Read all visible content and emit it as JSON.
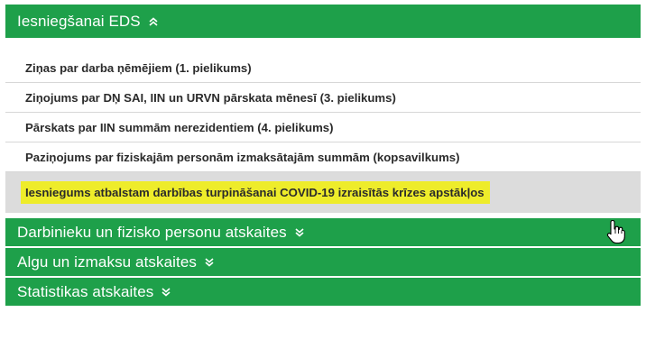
{
  "sections": [
    {
      "title": "Iesniegšanai EDS",
      "expanded": true,
      "items": [
        "Ziņas par darba ņēmējiem (1. pielikums)",
        "Ziņojums par DŅ SAI, IIN un URVN pārskata mēnesī (3. pielikums)",
        "Pārskats par IIN summām nerezidentiem (4. pielikums)",
        "Paziņojums par fiziskajām personām izmaksātajām summām (kopsavilkums)",
        "Iesniegums atbalstam darbības turpināšanai COVID-19 izraisītās krīzes apstākļos"
      ]
    },
    {
      "title": "Darbinieku un fizisko personu atskaites",
      "expanded": false
    },
    {
      "title": "Algu un izmaksu atskaites",
      "expanded": false
    },
    {
      "title": "Statistikas atskaites",
      "expanded": false
    }
  ],
  "colors": {
    "header_bg": "#1ea04a",
    "header_text": "#ffffff",
    "hover_row_bg": "#dcdcdc",
    "highlight": "#eeec2a"
  },
  "icons": {
    "expanded": "double-chevron-up-icon",
    "collapsed": "double-chevron-down-icon",
    "cursor": "hand-pointer-cursor-icon"
  }
}
